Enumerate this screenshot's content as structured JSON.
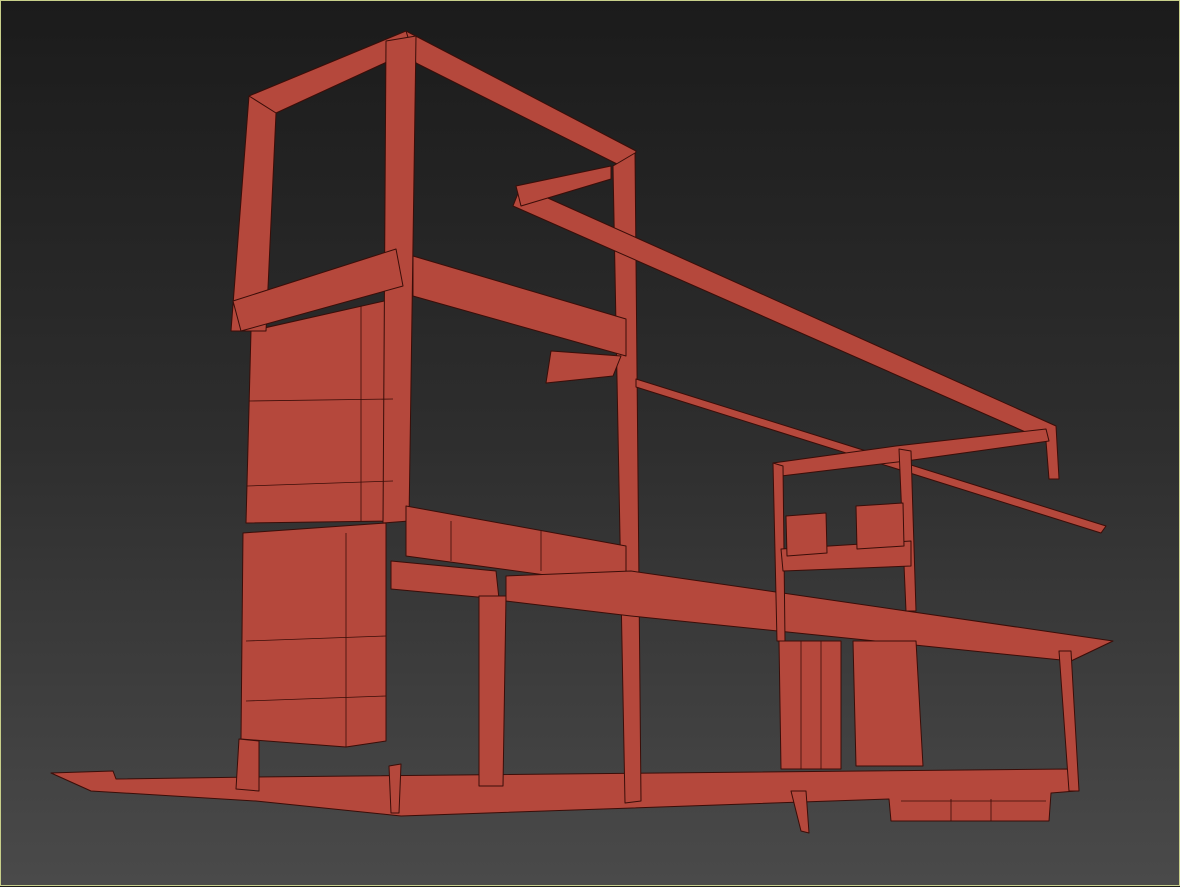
{
  "viewport": {
    "active_border_color": "#c8cf8a",
    "model_color": "#b5483c",
    "edge_color": "#3a0d08",
    "background_top": "#1b1b1b",
    "background_bottom": "#4a4a4a"
  }
}
